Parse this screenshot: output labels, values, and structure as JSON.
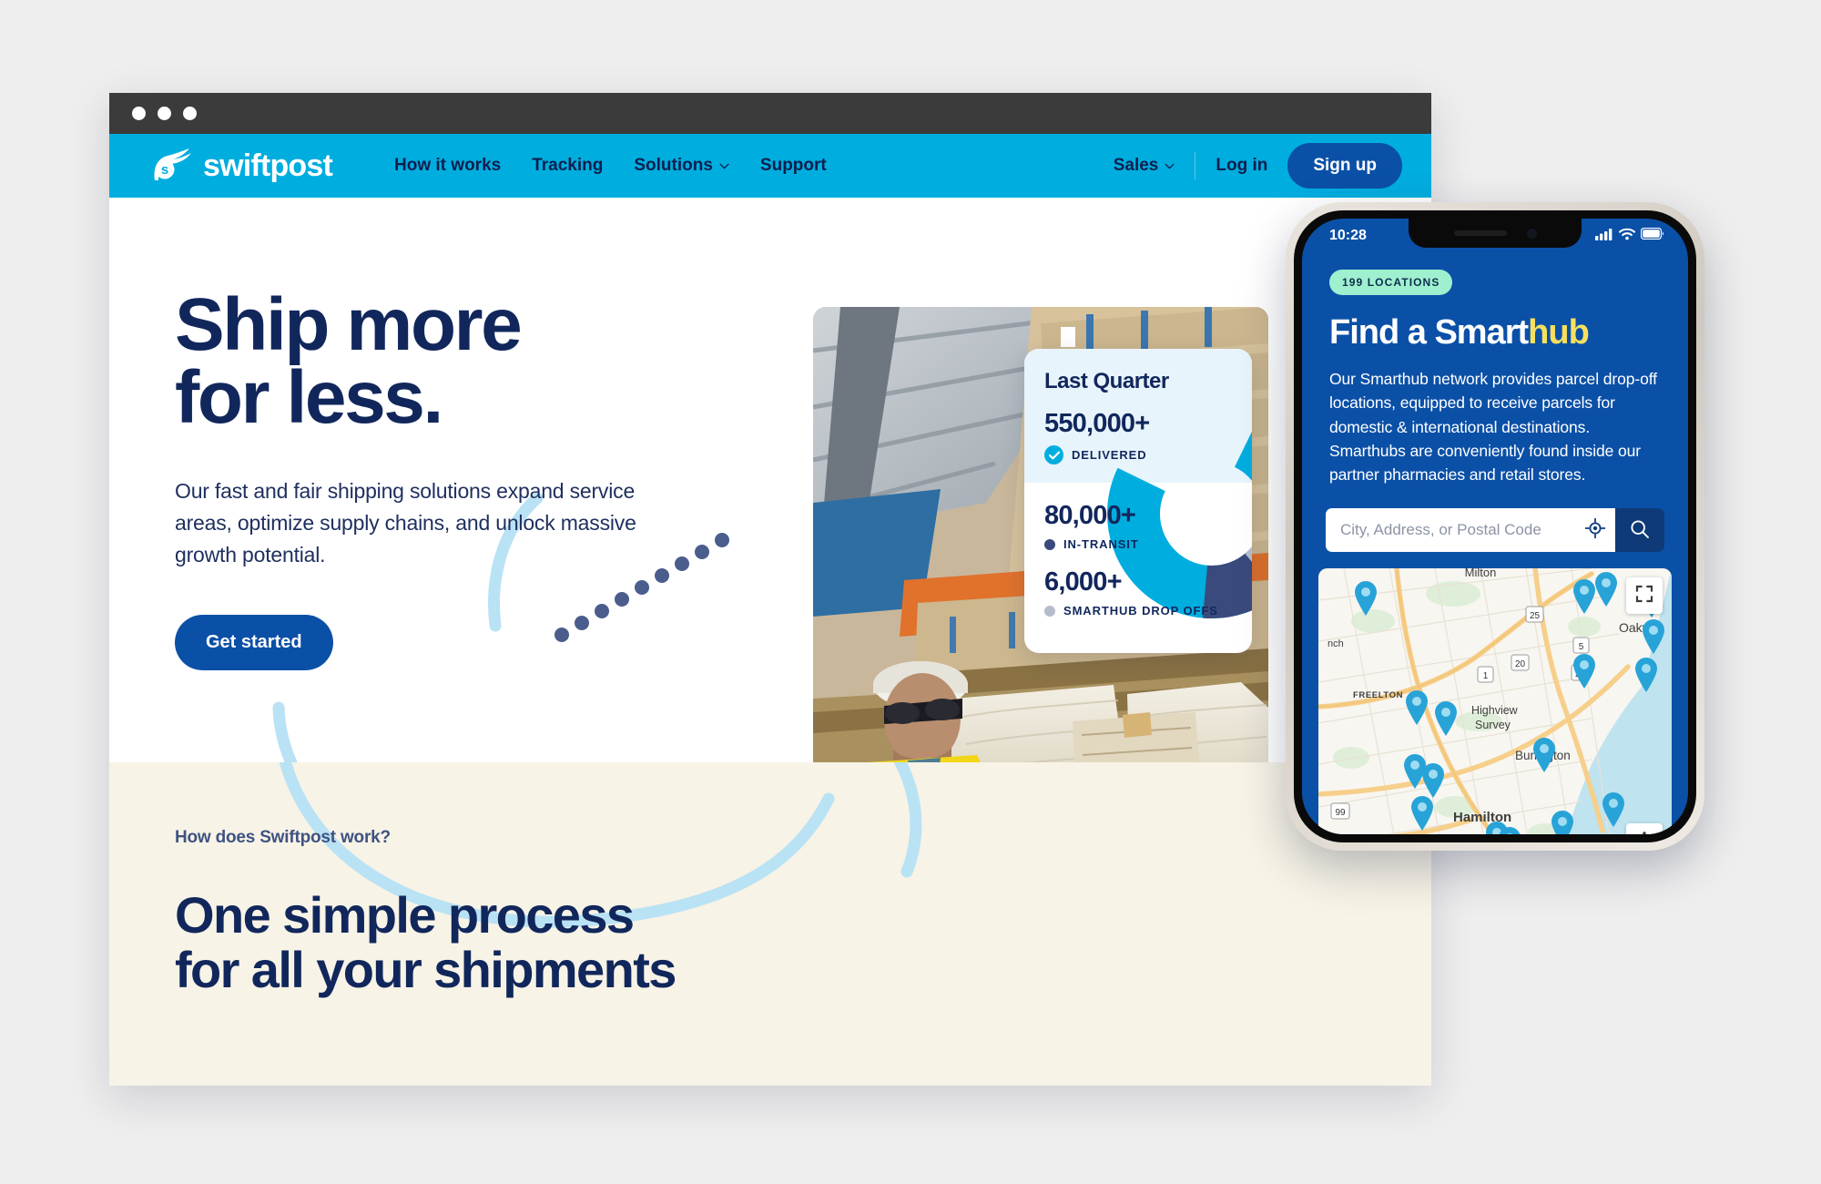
{
  "browser": {
    "titlebar_dots": 3
  },
  "nav": {
    "brand": "swiftpost",
    "links": [
      {
        "label": "How it works",
        "has_chevron": false
      },
      {
        "label": "Tracking",
        "has_chevron": false
      },
      {
        "label": "Solutions",
        "has_chevron": true
      },
      {
        "label": "Support",
        "has_chevron": false
      }
    ],
    "sales_label": "Sales",
    "login_label": "Log in",
    "signup_label": "Sign up"
  },
  "hero": {
    "heading_line1": "Ship more",
    "heading_line2": "for less.",
    "paragraph": "Our fast and fair shipping solutions expand service areas, optimize supply chains, and unlock massive growth potential.",
    "cta_label": "Get started"
  },
  "stat_card": {
    "title": "Last Quarter",
    "stats": [
      {
        "value": "550,000+",
        "label": "DELIVERED",
        "marker": "check",
        "color": "#00ADDF"
      },
      {
        "value": "80,000+",
        "label": "IN-TRANSIT",
        "marker": "dot",
        "color": "#3a4a7c"
      },
      {
        "value": "6,000+",
        "label": "SMARTHUB DROP OFFS",
        "marker": "dot",
        "color": "#b6bccd"
      }
    ]
  },
  "chart_data": {
    "type": "pie",
    "title": "Last Quarter",
    "categories": [
      "Delivered",
      "In-Transit",
      "Smarthub Drop Offs"
    ],
    "values": [
      550000,
      80000,
      6000
    ],
    "value_labels": [
      "550,000+",
      "80,000+",
      "6,000+"
    ],
    "colors": [
      "#00ADDF",
      "#3a4a7c",
      "#b6bccd"
    ],
    "donut": true,
    "legend": "left"
  },
  "cream_section": {
    "eyebrow": "How does Swiftpost work?",
    "heading_line1": "One simple process",
    "heading_line2": "for all your shipments"
  },
  "phone": {
    "status": {
      "time": "10:28",
      "signal_icon": "cellular-bars-icon",
      "wifi_icon": "wifi-icon",
      "battery_icon": "battery-icon"
    },
    "badge": "199 LOCATIONS",
    "heading_plain": "Find a Smart",
    "heading_accent": "hub",
    "paragraph": "Our Smarthub network provides parcel drop-off locations, equipped to receive parcels for domestic & international destinations. Smarthubs are conveniently found inside our partner pharmacies and retail stores.",
    "search_placeholder": "City, Address, or Postal Code",
    "search_value": "",
    "locate_icon": "crosshair-locate-icon",
    "search_icon": "search-icon",
    "map": {
      "fullscreen_icon": "fullscreen-icon",
      "zoom_in_label": "+",
      "place_labels": [
        "Milton",
        "Oakville",
        "FREELTON",
        "Highview Survey",
        "Burlington",
        "Hamilton",
        "nch"
      ],
      "highway_shields": [
        "25",
        "5",
        "20",
        "1",
        "25",
        "99"
      ],
      "pin_count": 23
    }
  },
  "colors": {
    "nav_cyan": "#00ADDF",
    "brand_navy": "#11275c",
    "button_blue": "#0b50a7",
    "phone_blue": "#0b50a7",
    "cream": "#f7f3e6",
    "accent_yellow": "#f7e05e",
    "badge_green": "#9ff0cf",
    "page_bg": "#eeeeee"
  }
}
